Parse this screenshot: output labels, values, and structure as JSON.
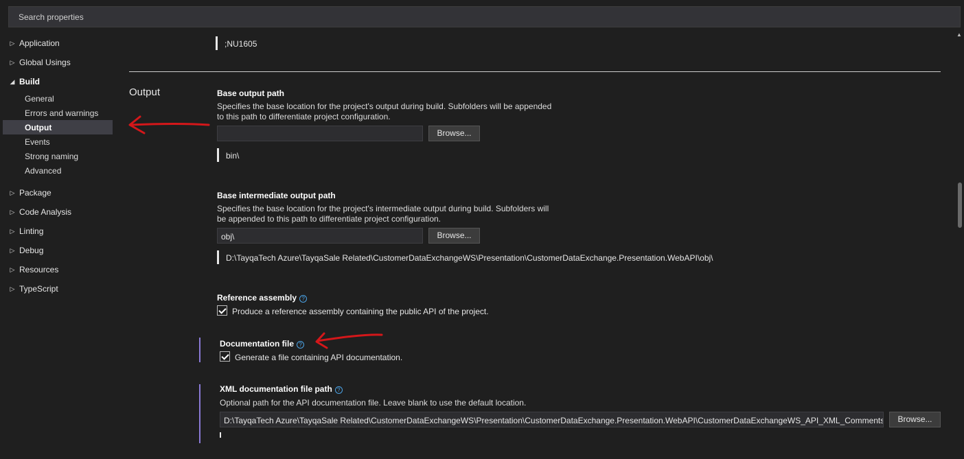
{
  "search": {
    "placeholder": "Search properties"
  },
  "sidebar": {
    "categories": [
      {
        "label": "Application"
      },
      {
        "label": "Global Usings"
      },
      {
        "label": "Build"
      },
      {
        "label": "Package"
      },
      {
        "label": "Code Analysis"
      },
      {
        "label": "Linting"
      },
      {
        "label": "Debug"
      },
      {
        "label": "Resources"
      },
      {
        "label": "TypeScript"
      }
    ],
    "build_items": [
      {
        "label": "General"
      },
      {
        "label": "Errors and warnings"
      },
      {
        "label": "Output",
        "selected": true
      },
      {
        "label": "Events"
      },
      {
        "label": "Strong naming"
      },
      {
        "label": "Advanced"
      }
    ]
  },
  "main": {
    "top_value": ";NU1605",
    "section_title": "Output",
    "base_output": {
      "title": "Base output path",
      "desc_line1": "Specifies the base location for the project's output during build. Subfolders will be appended",
      "desc_line2": "to this path to differentiate project configuration.",
      "value": "",
      "browse_label": "Browse...",
      "resolved": "bin\\"
    },
    "base_intermediate": {
      "title": "Base intermediate output path",
      "desc_line1": "Specifies the base location for the project's intermediate output during build. Subfolders will",
      "desc_line2": "be appended to this path to differentiate project configuration.",
      "value": "obj\\",
      "browse_label": "Browse...",
      "resolved": "D:\\TayqaTech Azure\\TayqaSale Related\\CustomerDataExchangeWS\\Presentation\\CustomerDataExchange.Presentation.WebAPI\\obj\\"
    },
    "reference_assembly": {
      "title": "Reference assembly",
      "checkbox_label": "Produce a reference assembly containing the public API of the project.",
      "checked": true
    },
    "documentation_file": {
      "title": "Documentation file",
      "checkbox_label": "Generate a file containing API documentation.",
      "checked": true
    },
    "xml_doc_path": {
      "title": "XML documentation file path",
      "desc": "Optional path for the API documentation file. Leave blank to use the default location.",
      "value": "D:\\TayqaTech Azure\\TayqaSale Related\\CustomerDataExchangeWS\\Presentation\\CustomerDataExchange.Presentation.WebAPI\\CustomerDataExchangeWS_API_XML_Comments.xml",
      "browse_label": "Browse..."
    }
  },
  "colors": {
    "background": "#1f1f1f",
    "accent_focus": "#8a7ad6",
    "annotation_red": "#d4171a",
    "help_icon": "#4ba3e6"
  }
}
